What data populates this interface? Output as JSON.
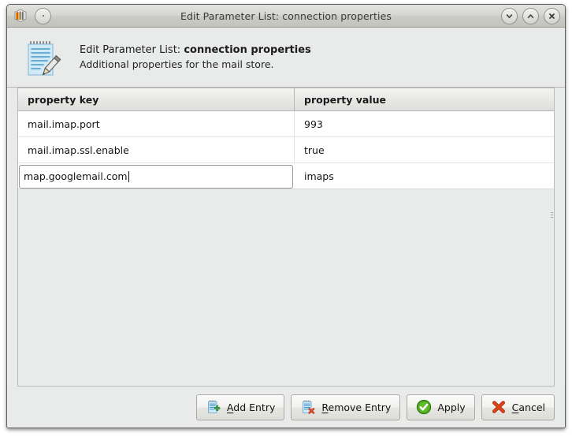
{
  "window": {
    "title": "Edit Parameter List: connection properties",
    "app_icon": "cube-stack-icon",
    "menu_button_icon": "window-menu-icon",
    "controls": [
      {
        "name": "minimize-button",
        "icon": "chevron-down-icon"
      },
      {
        "name": "maximize-button",
        "icon": "chevron-up-icon"
      },
      {
        "name": "close-button",
        "icon": "close-x-icon"
      }
    ]
  },
  "header": {
    "icon": "notepad-pencil-icon",
    "title_prefix": "Edit Parameter List: ",
    "title_strong": "connection properties",
    "subtitle": "Additional properties for the mail store."
  },
  "table": {
    "columns": [
      {
        "key": "property_key",
        "label": "property key"
      },
      {
        "key": "property_value",
        "label": "property value"
      }
    ],
    "rows": [
      {
        "key": "mail.imap.port",
        "value": "993",
        "editing": false
      },
      {
        "key": "mail.imap.ssl.enable",
        "value": "true",
        "editing": false
      },
      {
        "key": "map.googlemail.com",
        "value": "imaps",
        "editing": true
      }
    ]
  },
  "buttons": [
    {
      "name": "add-entry-button",
      "icon": "notepad-plus-icon",
      "mnemonic": "A",
      "before": "",
      "after": "dd Entry"
    },
    {
      "name": "remove-entry-button",
      "icon": "notepad-remove-icon",
      "mnemonic": "R",
      "before": "",
      "after": "emove Entry"
    },
    {
      "name": "apply-button",
      "icon": "green-check-circle-icon",
      "mnemonic": "",
      "before": "Apply",
      "after": ""
    },
    {
      "name": "cancel-button",
      "icon": "red-x-icon",
      "mnemonic": "C",
      "before": "",
      "after": "ancel"
    }
  ],
  "colors": {
    "accent_green": "#4aa317",
    "accent_red": "#c8390f",
    "window_bg": "#e9eaea",
    "titlebar_top": "#e2e2de",
    "titlebar_bottom": "#c3c3be"
  }
}
